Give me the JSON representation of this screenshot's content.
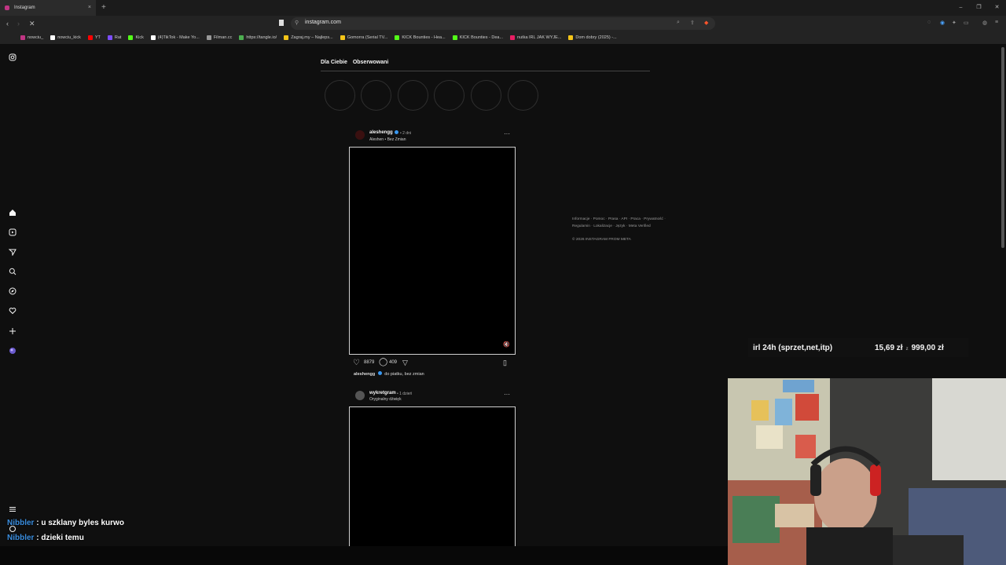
{
  "browser": {
    "tab_title": "Instagram",
    "tab_close": "×",
    "new_tab": "+",
    "url": "instagram.com",
    "window_controls": [
      "–",
      "❐",
      "✕"
    ],
    "bookmarks": [
      {
        "label": "nowciu_",
        "color": "#c13584"
      },
      {
        "label": "nowciu_kick",
        "color": "#ffffff"
      },
      {
        "label": "YT",
        "color": "#ff0000"
      },
      {
        "label": "Rat",
        "color": "#7c4dff"
      },
      {
        "label": "Kick",
        "color": "#53fc18"
      },
      {
        "label": "(4)TikTok - Make Yo...",
        "color": "#ffffff"
      },
      {
        "label": "Filman.cc",
        "color": "#999999"
      },
      {
        "label": "https://tangle.io/",
        "color": "#4caf50"
      },
      {
        "label": "Zagraj.my – Najleps...",
        "color": "#f5c518"
      },
      {
        "label": "Gomorra (Serial TV...",
        "color": "#f5c518"
      },
      {
        "label": "KICK Bounties - Hea...",
        "color": "#53fc18"
      },
      {
        "label": "KICK Bounties - Dea...",
        "color": "#53fc18"
      },
      {
        "label": "nutka IRL JAK WYJE...",
        "color": "#e91e63"
      },
      {
        "label": "Dom dobry (2025) -...",
        "color": "#f5c518"
      }
    ]
  },
  "feed": {
    "tabs": [
      "Dla Ciebie",
      "Obserwowani"
    ],
    "posts": [
      {
        "username": "aleshengg",
        "time": "• 2 dni",
        "subtitle": "Aleshen • Bez Zmian",
        "likes": "8879",
        "comments": "409",
        "caption_user": "aleshengg",
        "caption": "do piatku, bez zmian"
      },
      {
        "username": "wykretgram",
        "time": "• 1 dzień",
        "subtitle": "Oryginalny dźwięk"
      }
    ]
  },
  "footer": {
    "line1": "Informacje · Pomoc · Prasa · API · Praca · Prywatność ·",
    "line2": "Regulamin · Lokalizacje · Język · Meta Verified",
    "copyright": "© 2026 INSTAGRAM FROM META"
  },
  "overlay": {
    "goal_label": "irl 24h (sprzet,net,itp)",
    "goal_current": "15,69 zł",
    "goal_separator": "z",
    "goal_target": "999,00 zł",
    "chat": [
      {
        "user": "Nibbler",
        "message": " : u szklany byles kurwo"
      },
      {
        "user": "Nibbler",
        "message": " : dzieki temu"
      }
    ]
  }
}
